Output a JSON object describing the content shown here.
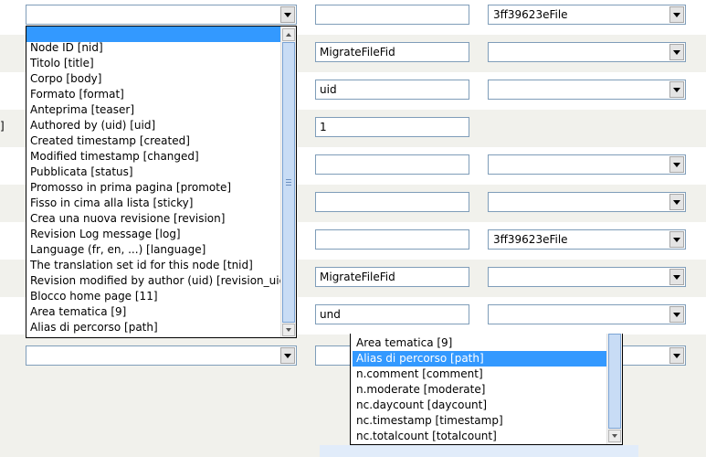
{
  "rows": [
    {
      "text_field": "",
      "select_value": "3ff39623eFile"
    },
    {
      "text_field": "MigrateFileFid",
      "select_value": ""
    },
    {
      "text_field": "uid",
      "select_value": ""
    },
    {
      "text_field": "1",
      "select_value": ""
    },
    {
      "text_field": "",
      "select_value": ""
    },
    {
      "text_field": "",
      "select_value": ""
    },
    {
      "text_field": "",
      "select_value": "3ff39623eFile"
    },
    {
      "text_field": "MigrateFileFid",
      "select_value": ""
    },
    {
      "text_field": "und",
      "select_value": ""
    }
  ],
  "left_edge_fragment": "]",
  "open_select_1": {
    "selected_value": "",
    "options": [
      "",
      "Node ID [nid]",
      "Titolo [title]",
      "Corpo [body]",
      "Formato [format]",
      "Anteprima [teaser]",
      "Authored by (uid) [uid]",
      "Created timestamp [created]",
      "Modified timestamp [changed]",
      "Pubblicata [status]",
      "Promosso in prima pagina [promote]",
      "Fisso in cima alla lista [sticky]",
      "Crea una nuova revisione [revision]",
      "Revision Log message [log]",
      "Language (fr, en, ...) [language]",
      "The translation set id for this node [tnid]",
      "Revision modified by author (uid) [revision_uid]",
      "Blocco home page [11]",
      "Area tematica [9]",
      "Alias di percorso [path]"
    ],
    "highlighted_index": 0
  },
  "open_select_2": {
    "options": [
      "Area tematica [9]",
      "Alias di percorso [path]",
      "n.comment [comment]",
      "n.moderate [moderate]",
      "nc.daycount [daycount]",
      "nc.timestamp [timestamp]",
      "nc.totalcount [totalcount]"
    ],
    "highlighted_index": 1
  },
  "colors": {
    "stripe": "#f1f1ec",
    "highlight": "#3399ff",
    "field_border": "#7f9db9"
  },
  "icons": [
    "dropdown-arrow-icon",
    "scroll-up-arrow-icon",
    "scroll-down-arrow-icon",
    "scrollbar-grip-icon"
  ]
}
